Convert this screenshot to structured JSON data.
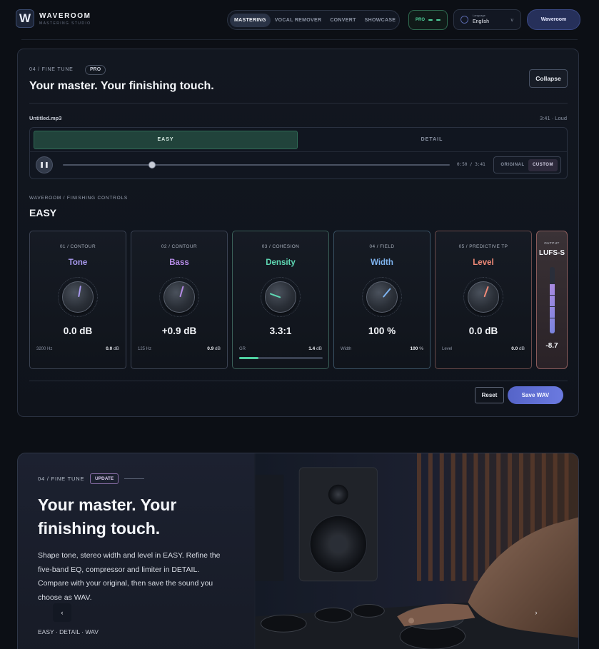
{
  "header": {
    "logo_letter": "W",
    "brand": "WAVEROOM",
    "brand_sub": "MASTERING STUDIO",
    "nav": [
      {
        "label": "MASTERING",
        "active": true
      },
      {
        "label": "VOCAL REMOVER",
        "active": false
      },
      {
        "label": "CONVERT",
        "active": false
      },
      {
        "label": "SHOWCASE",
        "active": false
      }
    ],
    "pro_badge": "PRO",
    "language": {
      "label": "Language",
      "value": "English",
      "chevron": "v"
    },
    "cta": "Waveroom"
  },
  "panel": {
    "kicker": "04 / FINE TUNE",
    "tag": "PRO",
    "title": "Your master. Your finishing touch.",
    "collapse": "Collapse",
    "file_name": "Untitled.mp3",
    "file_meta": "3:41 · Loud",
    "tabs": {
      "easy": "EASY",
      "detail": "DETAIL"
    },
    "player": {
      "progress": 0.23,
      "time": "0:50 / 3:41",
      "original": "ORIGINAL",
      "custom": "CUSTOM"
    },
    "controls_kicker": "WAVEROOM / FINISHING CONTROLS",
    "controls_title": "EASY",
    "cards": [
      {
        "kicker": "01 / CONTOUR",
        "name": "Tone",
        "color": "#a99af0",
        "needle_deg": 10,
        "value": "0.0 dB",
        "sub_left": "3200 Hz",
        "sub_right_v": "0.0",
        "sub_right_u": "dB",
        "border": "#3a4252"
      },
      {
        "kicker": "02 / CONTOUR",
        "name": "Bass",
        "color": "#b58be6",
        "needle_deg": 16,
        "value": "+0.9 dB",
        "sub_left": "125 Hz",
        "sub_right_v": "0.9",
        "sub_right_u": "dB",
        "border": "#3a4252"
      },
      {
        "kicker": "03 / COHESION",
        "name": "Density",
        "color": "#5fd8b4",
        "needle_deg": -70,
        "value": "3.3:1",
        "sub_left": "GR",
        "sub_right_v": "1.4",
        "sub_right_u": "dB",
        "border": "#3a5f58",
        "gr_fraction": 0.23
      },
      {
        "kicker": "04 / FIELD",
        "name": "Width",
        "color": "#7fb4f0",
        "needle_deg": 40,
        "value": "100 %",
        "sub_left": "Width",
        "sub_right_v": "100",
        "sub_right_u": "%",
        "border": "#3a5264"
      },
      {
        "kicker": "05 / PREDICTIVE TP",
        "name": "Level",
        "color": "#f08a78",
        "needle_deg": 20,
        "value": "0.0 dB",
        "sub_left": "Level",
        "sub_right_v": "0.0",
        "sub_right_u": "dB",
        "border": "#6a4a4a"
      }
    ],
    "output": {
      "label": "OUTPUT",
      "unit": "LUFS-S",
      "value": "-8.7",
      "level": 0.75
    },
    "reset": "Reset",
    "save": "Save WAV"
  },
  "hero": {
    "kicker": "04 / FINE TUNE",
    "tag": "UPDATE",
    "title": "Your master. Your finishing touch.",
    "description": "Shape tone, stereo width and level in EASY. Refine the five-band EQ, compressor and limiter in DETAIL. Compare with your original, then save the sound you choose as WAV.",
    "footer": "EASY · DETAIL · WAV",
    "prev": "‹",
    "next": "›"
  }
}
